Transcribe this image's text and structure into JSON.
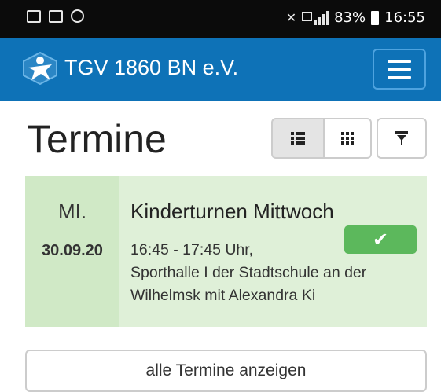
{
  "status_bar": {
    "left_icons": [
      "mail-icon",
      "image-icon",
      "clock-icon"
    ],
    "right_icons": [
      "mute-icon",
      "signal-icon"
    ],
    "battery": "83%",
    "time": "16:55"
  },
  "navbar": {
    "brand": "TGV 1860 BN e.V.",
    "logo_icon": "tgv-logo-icon",
    "menu_icon": "hamburger-icon",
    "color": "#0e72b7"
  },
  "page": {
    "title": "Termine",
    "view_buttons": [
      {
        "icon": "list-view-icon",
        "active": true
      },
      {
        "icon": "grid-view-icon",
        "active": false
      },
      {
        "icon": "filter-icon",
        "active": false
      }
    ]
  },
  "event": {
    "weekday": "MI.",
    "date": "30.09.20",
    "title": "Kinderturnen Mittwoch",
    "time": "16:45 - 17:45 Uhr,",
    "location_line1": "Sporthalle I der Stadtschule an der",
    "location_line2": "Wilhelmsk mit Alexandra Ki",
    "status_icon": "checkmark-icon",
    "status_color": "#5cb85c"
  },
  "footer": {
    "all_button": "alle Termine anzeigen"
  }
}
